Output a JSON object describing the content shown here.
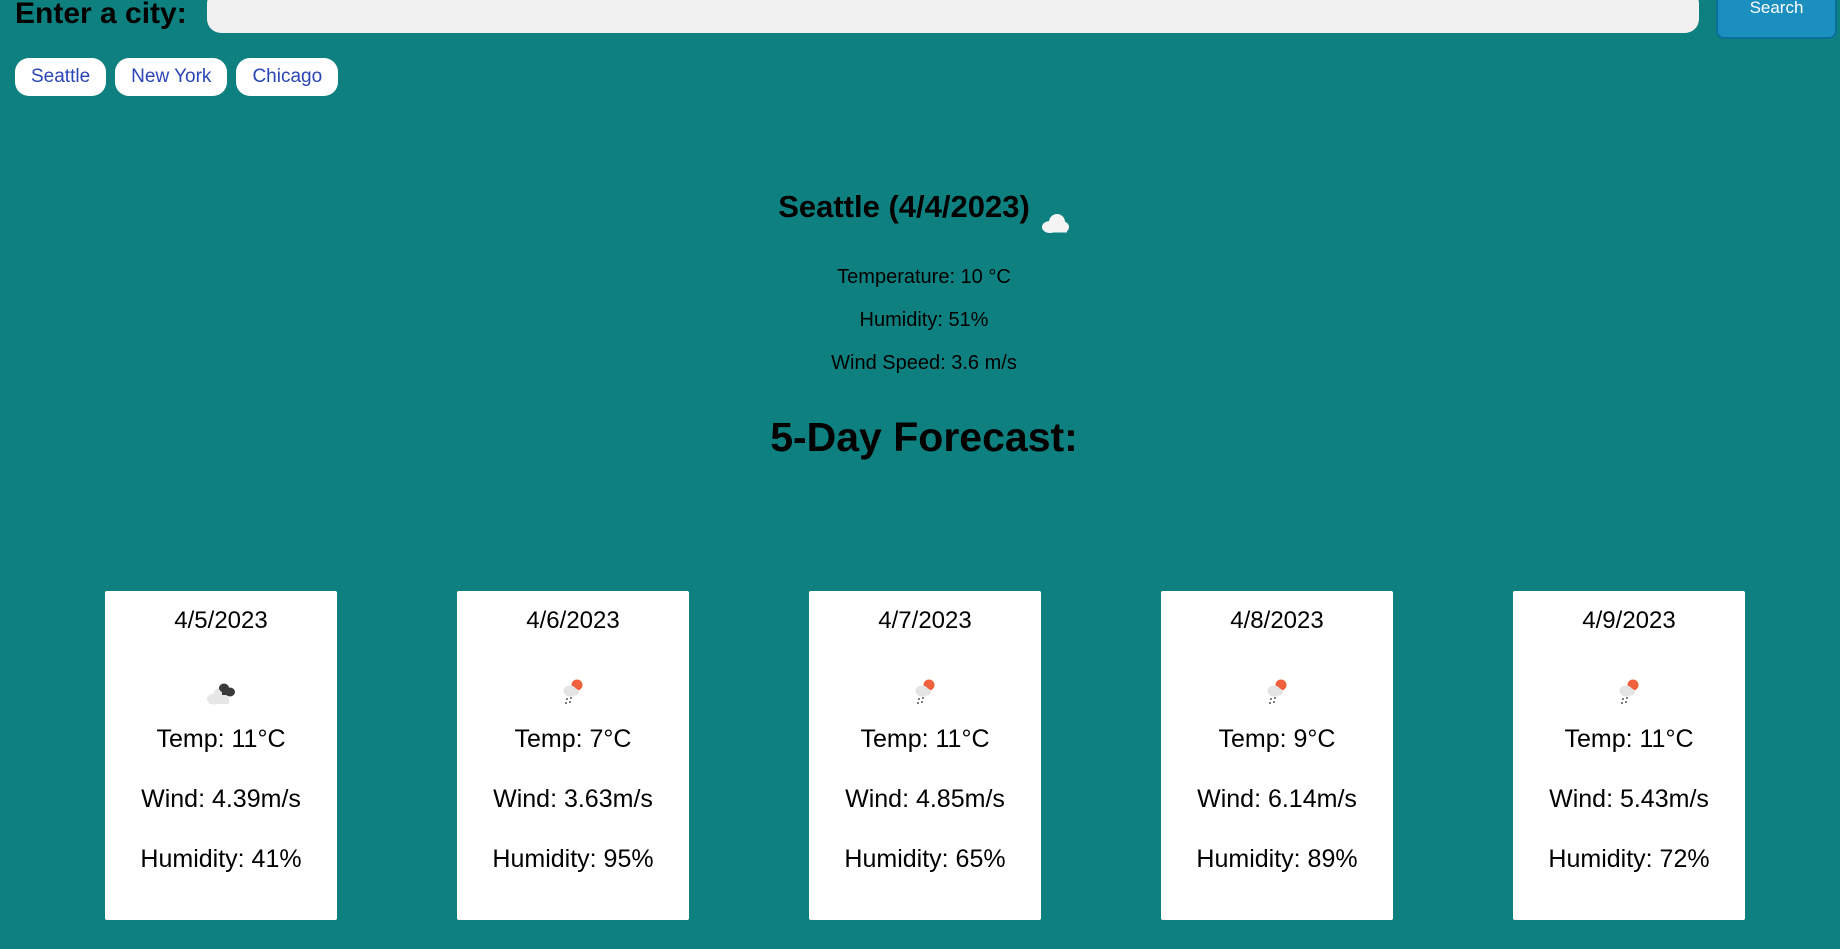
{
  "search": {
    "label": "Enter a city:",
    "input_value": "",
    "placeholder": "",
    "button_label": "Search"
  },
  "history": [
    {
      "label": "Seattle"
    },
    {
      "label": "New York"
    },
    {
      "label": "Chicago"
    }
  ],
  "current": {
    "title": "Seattle (4/4/2023)",
    "icon": "cloud-icon",
    "temperature": "Temperature: 10 °C",
    "humidity": "Humidity: 51%",
    "wind": "Wind Speed: 3.6 m/s"
  },
  "forecast": {
    "title": "5-Day Forecast:",
    "days": [
      {
        "date": "4/5/2023",
        "icon": "broken-clouds-icon",
        "temp": "Temp: 11°C",
        "wind": "Wind: 4.39m/s",
        "humidity": "Humidity: 41%"
      },
      {
        "date": "4/6/2023",
        "icon": "sun-rain-icon",
        "temp": "Temp: 7°C",
        "wind": "Wind: 3.63m/s",
        "humidity": "Humidity: 95%"
      },
      {
        "date": "4/7/2023",
        "icon": "sun-rain-icon",
        "temp": "Temp: 11°C",
        "wind": "Wind: 4.85m/s",
        "humidity": "Humidity: 65%"
      },
      {
        "date": "4/8/2023",
        "icon": "sun-rain-icon",
        "temp": "Temp: 9°C",
        "wind": "Wind: 6.14m/s",
        "humidity": "Humidity: 89%"
      },
      {
        "date": "4/9/2023",
        "icon": "sun-rain-icon",
        "temp": "Temp: 11°C",
        "wind": "Wind: 5.43m/s",
        "humidity": "Humidity: 72%"
      }
    ]
  },
  "colors": {
    "background": "#0e8080",
    "search_button": "#1b8fc0",
    "history_text": "#2a45b5",
    "card": "#ffffff"
  }
}
